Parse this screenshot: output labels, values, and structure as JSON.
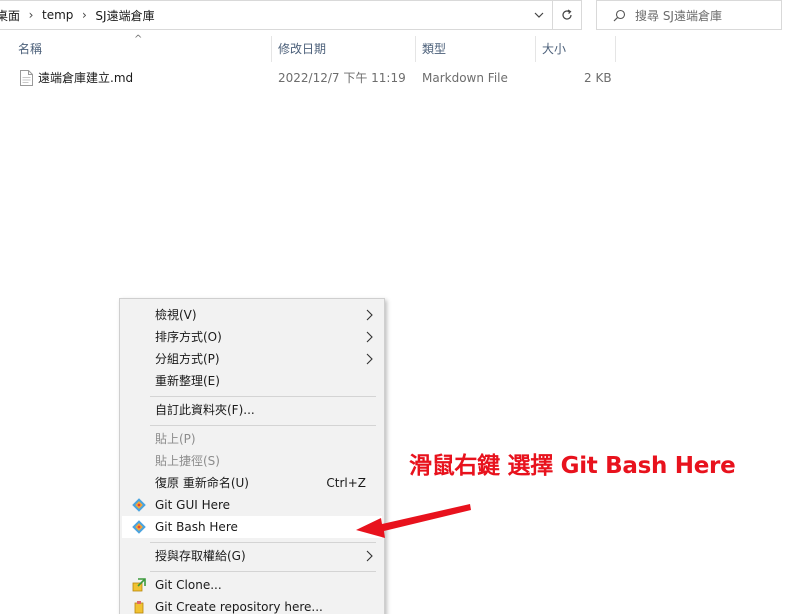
{
  "address_bar": {
    "crumbs": [
      "桌面",
      "temp",
      "SJ遠端倉庫"
    ]
  },
  "search": {
    "placeholder": "搜尋 SJ遠端倉庫"
  },
  "columns": {
    "name": "名稱",
    "date_modified": "修改日期",
    "type": "類型",
    "size": "大小"
  },
  "files": [
    {
      "name": "遠端倉庫建立.md",
      "date_modified": "2022/12/7 下午 11:19",
      "type": "Markdown File",
      "size": "2 KB"
    }
  ],
  "context_menu": {
    "items": [
      {
        "label": "檢視(V)"
      },
      {
        "label": "排序方式(O)"
      },
      {
        "label": "分組方式(P)"
      },
      {
        "label": "重新整理(E)"
      },
      {
        "label": "自訂此資料夾(F)..."
      },
      {
        "label": "貼上(P)"
      },
      {
        "label": "貼上捷徑(S)"
      },
      {
        "label": "復原 重新命名(U)",
        "shortcut": "Ctrl+Z"
      },
      {
        "label": "Git GUI Here"
      },
      {
        "label": "Git Bash Here"
      },
      {
        "label": "授與存取權給(G)"
      },
      {
        "label": "Git Clone..."
      },
      {
        "label": "Git Create repository here..."
      }
    ]
  },
  "annotation": {
    "text": "滑鼠右鍵 選擇 Git Bash Here",
    "color": "#e8121d"
  },
  "colors": {
    "menu_bg": "#f2f2f2",
    "header_text": "#4c607a",
    "highlight": "#ffffff"
  }
}
